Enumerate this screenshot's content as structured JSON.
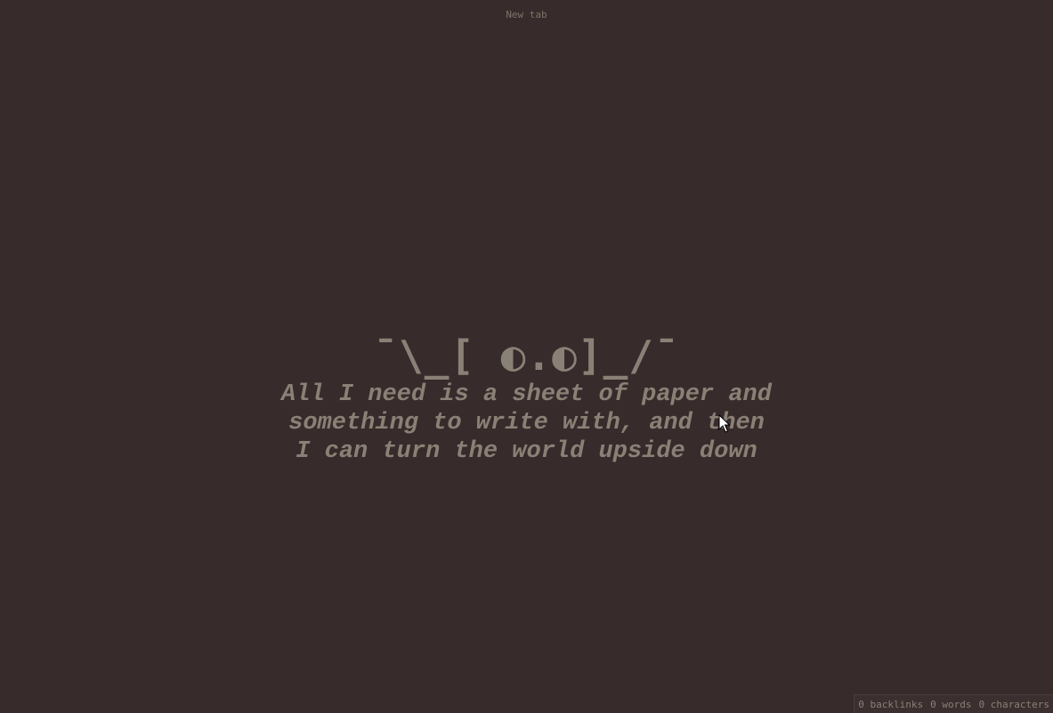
{
  "tab": {
    "title": "New tab"
  },
  "empty_state": {
    "emoticon": "¯\\_[ ◐.◐]_/¯",
    "quote_lines": [
      "All I need is a sheet of paper and",
      "something to write with, and then",
      "I can turn the world upside down"
    ]
  },
  "status_bar": {
    "backlinks": "0 backlinks",
    "words": "0 words",
    "characters": "0 characters"
  },
  "colors": {
    "background": "#372b2b",
    "text": "#8a8176"
  }
}
